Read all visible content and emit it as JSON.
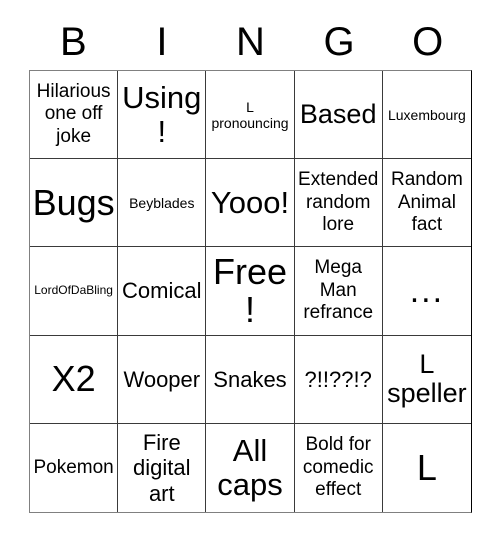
{
  "card": {
    "title": "BINGO",
    "header_letters": [
      "B",
      "I",
      "N",
      "G",
      "O"
    ],
    "free_space": "Free!",
    "colors": {
      "background": "#ffffff",
      "text": "#000000",
      "grid_line": "#3a3a3a",
      "outer_border": "#808080"
    },
    "grid": {
      "columns": 5,
      "rows": 5,
      "cells": [
        [
          {
            "text": "Hilarious one off joke",
            "size": "md"
          },
          {
            "text": "Using !",
            "size": "2xl"
          },
          {
            "text": "L pronouncing",
            "size": "sm"
          },
          {
            "text": "Based",
            "size": "xl"
          },
          {
            "text": "Luxembourg",
            "size": "sm"
          }
        ],
        [
          {
            "text": "Bugs",
            "size": "3xl"
          },
          {
            "text": "Beyblades",
            "size": "sm"
          },
          {
            "text": "Yooo!",
            "size": "2xl"
          },
          {
            "text": "Extended random lore",
            "size": "md"
          },
          {
            "text": "Random Animal fact",
            "size": "md"
          }
        ],
        [
          {
            "text": "LordOfDaBling",
            "size": "xs"
          },
          {
            "text": "Comical",
            "size": "lg"
          },
          {
            "text": "Free!",
            "size": "3xl"
          },
          {
            "text": "Mega Man refrance",
            "size": "md"
          },
          {
            "text": "...",
            "size": "dots"
          }
        ],
        [
          {
            "text": "X2",
            "size": "3xl"
          },
          {
            "text": "Wooper",
            "size": "lg"
          },
          {
            "text": "Snakes",
            "size": "lg"
          },
          {
            "text": "?!!??!?",
            "size": "lg"
          },
          {
            "text": "L speller",
            "size": "xl"
          }
        ],
        [
          {
            "text": "Pokemon",
            "size": "md"
          },
          {
            "text": "Fire digital art",
            "size": "lg"
          },
          {
            "text": "All caps",
            "size": "2xl"
          },
          {
            "text": "Bold for comedic effect",
            "size": "md"
          },
          {
            "text": "L",
            "size": "3xl"
          }
        ]
      ]
    }
  }
}
